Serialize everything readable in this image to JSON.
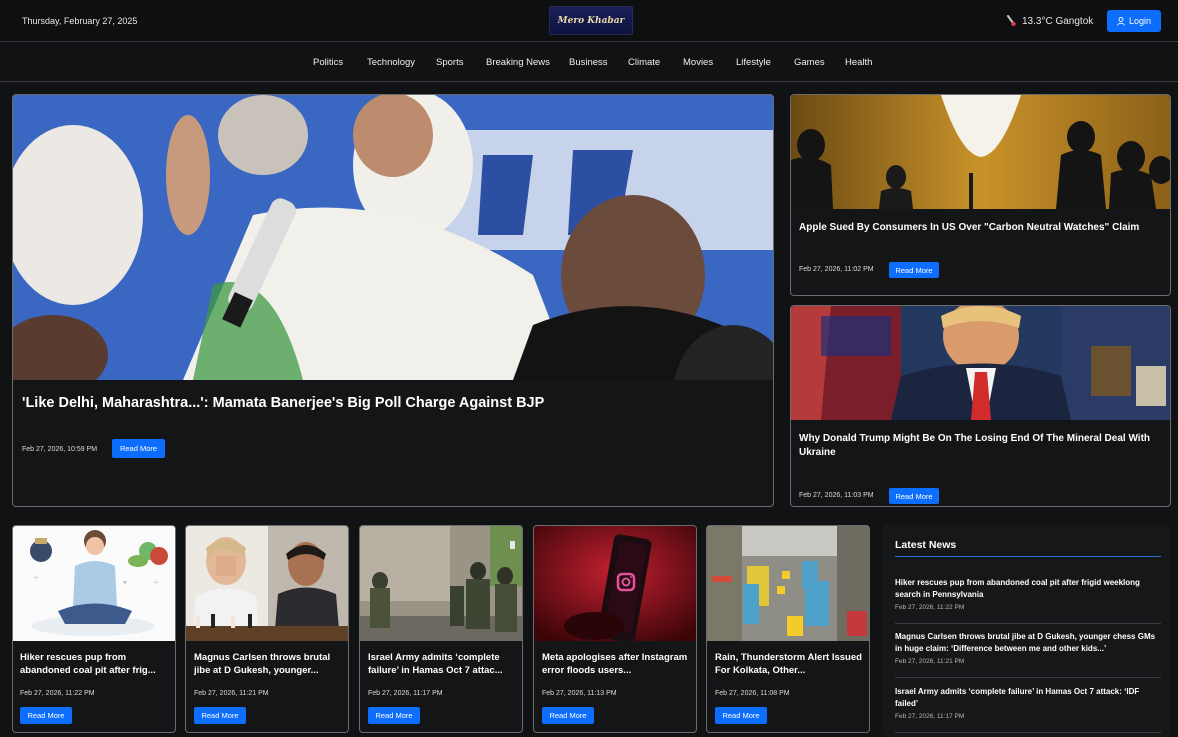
{
  "header": {
    "date": "Thursday, February 27, 2025",
    "logo_text": "Mero Khabar",
    "weather": "13.3°C Gangtok",
    "login_label": "Login"
  },
  "nav": [
    "Politics",
    "Technology",
    "Sports",
    "Breaking News",
    "Business",
    "Climate",
    "Movies",
    "Lifestyle",
    "Games",
    "Health"
  ],
  "hero": {
    "title": "'Like Delhi, Maharashtra...': Mamata Banerjee's Big Poll Charge Against BJP",
    "time": "Feb 27, 2026, 10:59 PM",
    "read_more": "Read More"
  },
  "side": [
    {
      "title": "Apple Sued By Consumers In US Over \"Carbon Neutral Watches\" Claim",
      "time": "Feb 27, 2026, 11:02 PM",
      "read_more": "Read More"
    },
    {
      "title": "Why Donald Trump Might Be On The Losing End Of The Mineral Deal With Ukraine",
      "time": "Feb 27, 2026, 11:03 PM",
      "read_more": "Read More"
    }
  ],
  "grid": [
    {
      "title": "Hiker rescues pup from abandoned coal pit after frig...",
      "time": "Feb 27, 2026, 11:22 PM",
      "read_more": "Read More"
    },
    {
      "title": "Magnus Carlsen throws brutal jibe at D Gukesh, younger...",
      "time": "Feb 27, 2026, 11:21 PM",
      "read_more": "Read More"
    },
    {
      "title": "Israel Army admits ‘complete failure’ in Hamas Oct 7 attac...",
      "time": "Feb 27, 2026, 11:17 PM",
      "read_more": "Read More"
    },
    {
      "title": "Meta apologises after Instagram error floods users...",
      "time": "Feb 27, 2026, 11:13 PM",
      "read_more": "Read More"
    },
    {
      "title": "Rain, Thunderstorm Alert Issued For Kolkata, Other...",
      "time": "Feb 27, 2026, 11:08 PM",
      "read_more": "Read More"
    }
  ],
  "latest": {
    "heading": "Latest News",
    "items": [
      {
        "title": "Hiker rescues pup from abandoned coal pit after frigid weeklong search in Pennsylvania",
        "time": "Feb 27, 2026, 11:22 PM"
      },
      {
        "title": "Magnus Carlsen throws brutal jibe at D Gukesh, younger chess GMs in huge claim: ‘Difference between me and other kids...’",
        "time": "Feb 27, 2026, 11:21 PM"
      },
      {
        "title": "Israel Army admits ‘complete failure’ in Hamas Oct 7 attack: ‘IDF failed’",
        "time": "Feb 27, 2026, 11:17 PM"
      }
    ]
  },
  "colors": {
    "accent": "#0d6efd",
    "background": "#111214",
    "card": "#141517"
  },
  "icons": {
    "weather": "thermometer-icon",
    "login": "user-icon"
  }
}
